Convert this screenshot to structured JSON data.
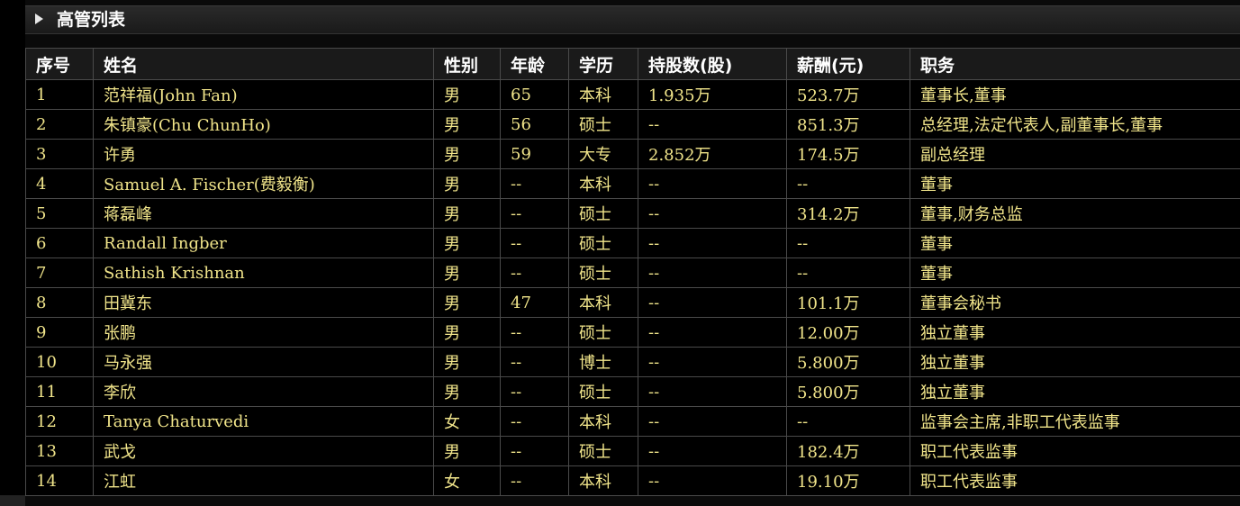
{
  "panel": {
    "title": "高管列表"
  },
  "table": {
    "columns": [
      "序号",
      "姓名",
      "性别",
      "年龄",
      "学历",
      "持股数(股)",
      "薪酬(元)",
      "职务"
    ],
    "rows": [
      [
        "1",
        "范祥福(John Fan)",
        "男",
        "65",
        "本科",
        "1.935万",
        "523.7万",
        "董事长,董事"
      ],
      [
        "2",
        "朱镇豪(Chu ChunHo)",
        "男",
        "56",
        "硕士",
        "--",
        "851.3万",
        "总经理,法定代表人,副董事长,董事"
      ],
      [
        "3",
        "许勇",
        "男",
        "59",
        "大专",
        "2.852万",
        "174.5万",
        "副总经理"
      ],
      [
        "4",
        "Samuel A. Fischer(费毅衡)",
        "男",
        "--",
        "本科",
        "--",
        "--",
        "董事"
      ],
      [
        "5",
        "蒋磊峰",
        "男",
        "--",
        "硕士",
        "--",
        "314.2万",
        "董事,财务总监"
      ],
      [
        "6",
        "Randall Ingber",
        "男",
        "--",
        "硕士",
        "--",
        "--",
        "董事"
      ],
      [
        "7",
        "Sathish Krishnan",
        "男",
        "--",
        "硕士",
        "--",
        "--",
        "董事"
      ],
      [
        "8",
        "田冀东",
        "男",
        "47",
        "本科",
        "--",
        "101.1万",
        "董事会秘书"
      ],
      [
        "9",
        "张鹏",
        "男",
        "--",
        "硕士",
        "--",
        "12.00万",
        "独立董事"
      ],
      [
        "10",
        "马永强",
        "男",
        "--",
        "博士",
        "--",
        "5.800万",
        "独立董事"
      ],
      [
        "11",
        "李欣",
        "男",
        "--",
        "硕士",
        "--",
        "5.800万",
        "独立董事"
      ],
      [
        "12",
        "Tanya Chaturvedi",
        "女",
        "--",
        "本科",
        "--",
        "--",
        "监事会主席,非职工代表监事"
      ],
      [
        "13",
        "武戈",
        "男",
        "--",
        "硕士",
        "--",
        "182.4万",
        "职工代表监事"
      ],
      [
        "14",
        "江虹",
        "女",
        "--",
        "本科",
        "--",
        "19.10万",
        "职工代表监事"
      ]
    ]
  },
  "colors": {
    "header_text": "#ffffff",
    "cell_text": "#f0e48a",
    "grid": "#4a4a4a",
    "background": "#000000"
  },
  "icons": {
    "title_toggle": "triangle-right-icon"
  }
}
